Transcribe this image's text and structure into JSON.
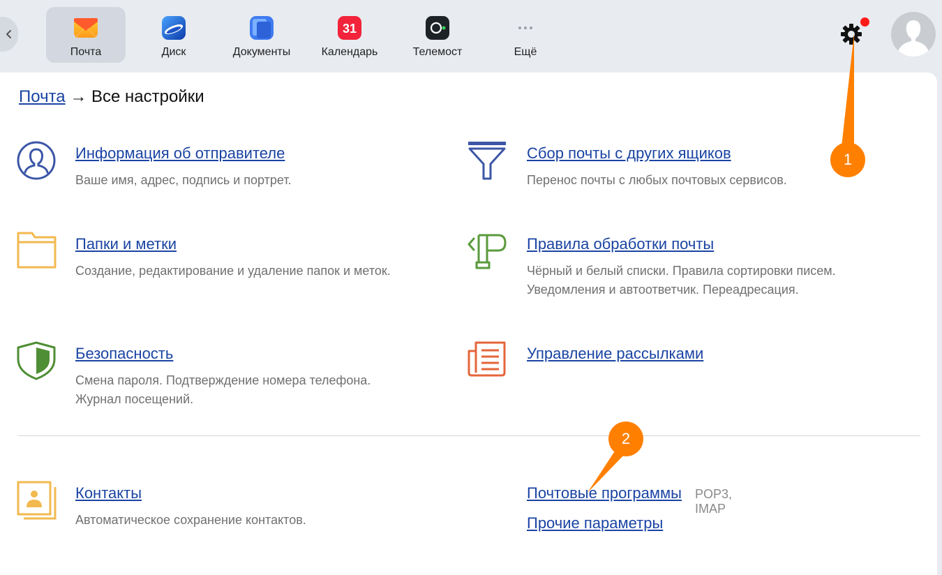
{
  "header": {
    "apps": [
      {
        "label": "Почта",
        "icon": "mail-envelope-icon",
        "active": true
      },
      {
        "label": "Диск",
        "icon": "disk-icon",
        "active": false
      },
      {
        "label": "Документы",
        "icon": "documents-icon",
        "active": false
      },
      {
        "label": "Календарь",
        "icon": "calendar-icon",
        "active": false,
        "badge": "31"
      },
      {
        "label": "Телемост",
        "icon": "telemost-icon",
        "active": false
      },
      {
        "label": "Ещё",
        "icon": "more-dots-icon",
        "active": false
      }
    ]
  },
  "breadcrumb": {
    "link": "Почта",
    "separator": "→",
    "current": "Все настройки"
  },
  "sections": {
    "sender": {
      "title": "Информация об отправителе",
      "desc": [
        "Ваше имя, адрес, подпись и портрет."
      ],
      "icon": "person-circle-icon"
    },
    "collect": {
      "title": "Сбор почты с других ящиков",
      "desc": [
        "Перенос почты с любых почтовых сервисов."
      ],
      "icon": "funnel-icon"
    },
    "folders": {
      "title": "Папки и метки",
      "desc": [
        "Создание, редактирование и удаление папок и меток."
      ],
      "icon": "folder-icon"
    },
    "rules": {
      "title": "Правила обработки почты",
      "desc": [
        "Чёрный и белый списки. Правила сортировки писем.",
        "Уведомления и автоответчик. Переадресация."
      ],
      "icon": "signpost-icon"
    },
    "security": {
      "title": "Безопасность",
      "desc": [
        "Смена пароля. Подтверждение номера телефона.",
        "Журнал посещений."
      ],
      "icon": "shield-icon"
    },
    "subscriptions": {
      "title": "Управление рассылками",
      "icon": "newsletter-icon"
    },
    "contacts": {
      "title": "Контакты",
      "desc": [
        "Автоматическое сохранение контактов."
      ],
      "icon": "contacts-card-icon"
    },
    "mail_programs": {
      "title": "Почтовые программы",
      "note": "POP3, IMAP"
    },
    "other": {
      "title": "Прочие параметры"
    }
  },
  "annotations": [
    {
      "label": "1"
    },
    {
      "label": "2"
    }
  ],
  "colors": {
    "link": "#1a44a3",
    "marker": "#ff8000",
    "notification": "#ff1a1a",
    "muted": "#707070"
  }
}
